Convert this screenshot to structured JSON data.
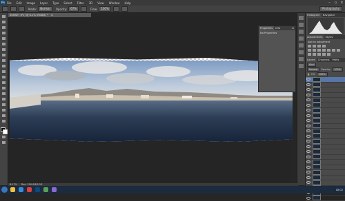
{
  "app": {
    "logo": "Ps"
  },
  "menu": [
    "File",
    "Edit",
    "Image",
    "Layer",
    "Type",
    "Select",
    "Filter",
    "3D",
    "View",
    "Window",
    "Help"
  ],
  "window_controls": [
    "–",
    "▫",
    "×"
  ],
  "options_bar": {
    "mode_label": "Mode:",
    "mode_value": "Normal",
    "opacity_label": "Opacity:",
    "opacity_value": "67%",
    "flow_label": "Flow:",
    "flow_value": "100%",
    "workspace": "Photography"
  },
  "document": {
    "tab_title": "SUNSET (P1) @ 8.1% (RGB/8) *",
    "close": "×"
  },
  "properties_panel": {
    "tabs": [
      "Properties",
      "Info"
    ],
    "body": "No Properties"
  },
  "right_panels": {
    "histogram_tabs": [
      "Histogram",
      "Navigator"
    ],
    "adjustments_tabs": [
      "Adjustments",
      "Styles"
    ],
    "adjustments_title": "Add an adjustment",
    "layers_tabs": [
      "Layers",
      "Channels",
      "Paths"
    ],
    "kind_label": "Kind",
    "blend_mode": "Normal",
    "opacity_label": "Opacity:",
    "opacity_value": "100%",
    "fill_label": "Fill:",
    "fill_value": "100%",
    "layers": [
      "",
      "",
      "",
      "",
      "",
      "",
      "",
      "",
      "",
      "",
      "",
      "",
      "",
      "",
      "",
      "",
      "",
      "",
      "",
      "",
      "",
      "",
      "",
      ""
    ]
  },
  "status_bar": {
    "zoom": "8.17%",
    "doc": "Doc: 200.0M/3.0G"
  },
  "taskbar": {
    "time": "18:02",
    "date": ""
  },
  "colors": {
    "accent": "#5877a8",
    "menu_bg": "#3a3a3a",
    "taskbar_bg": "#1c2b3e"
  }
}
